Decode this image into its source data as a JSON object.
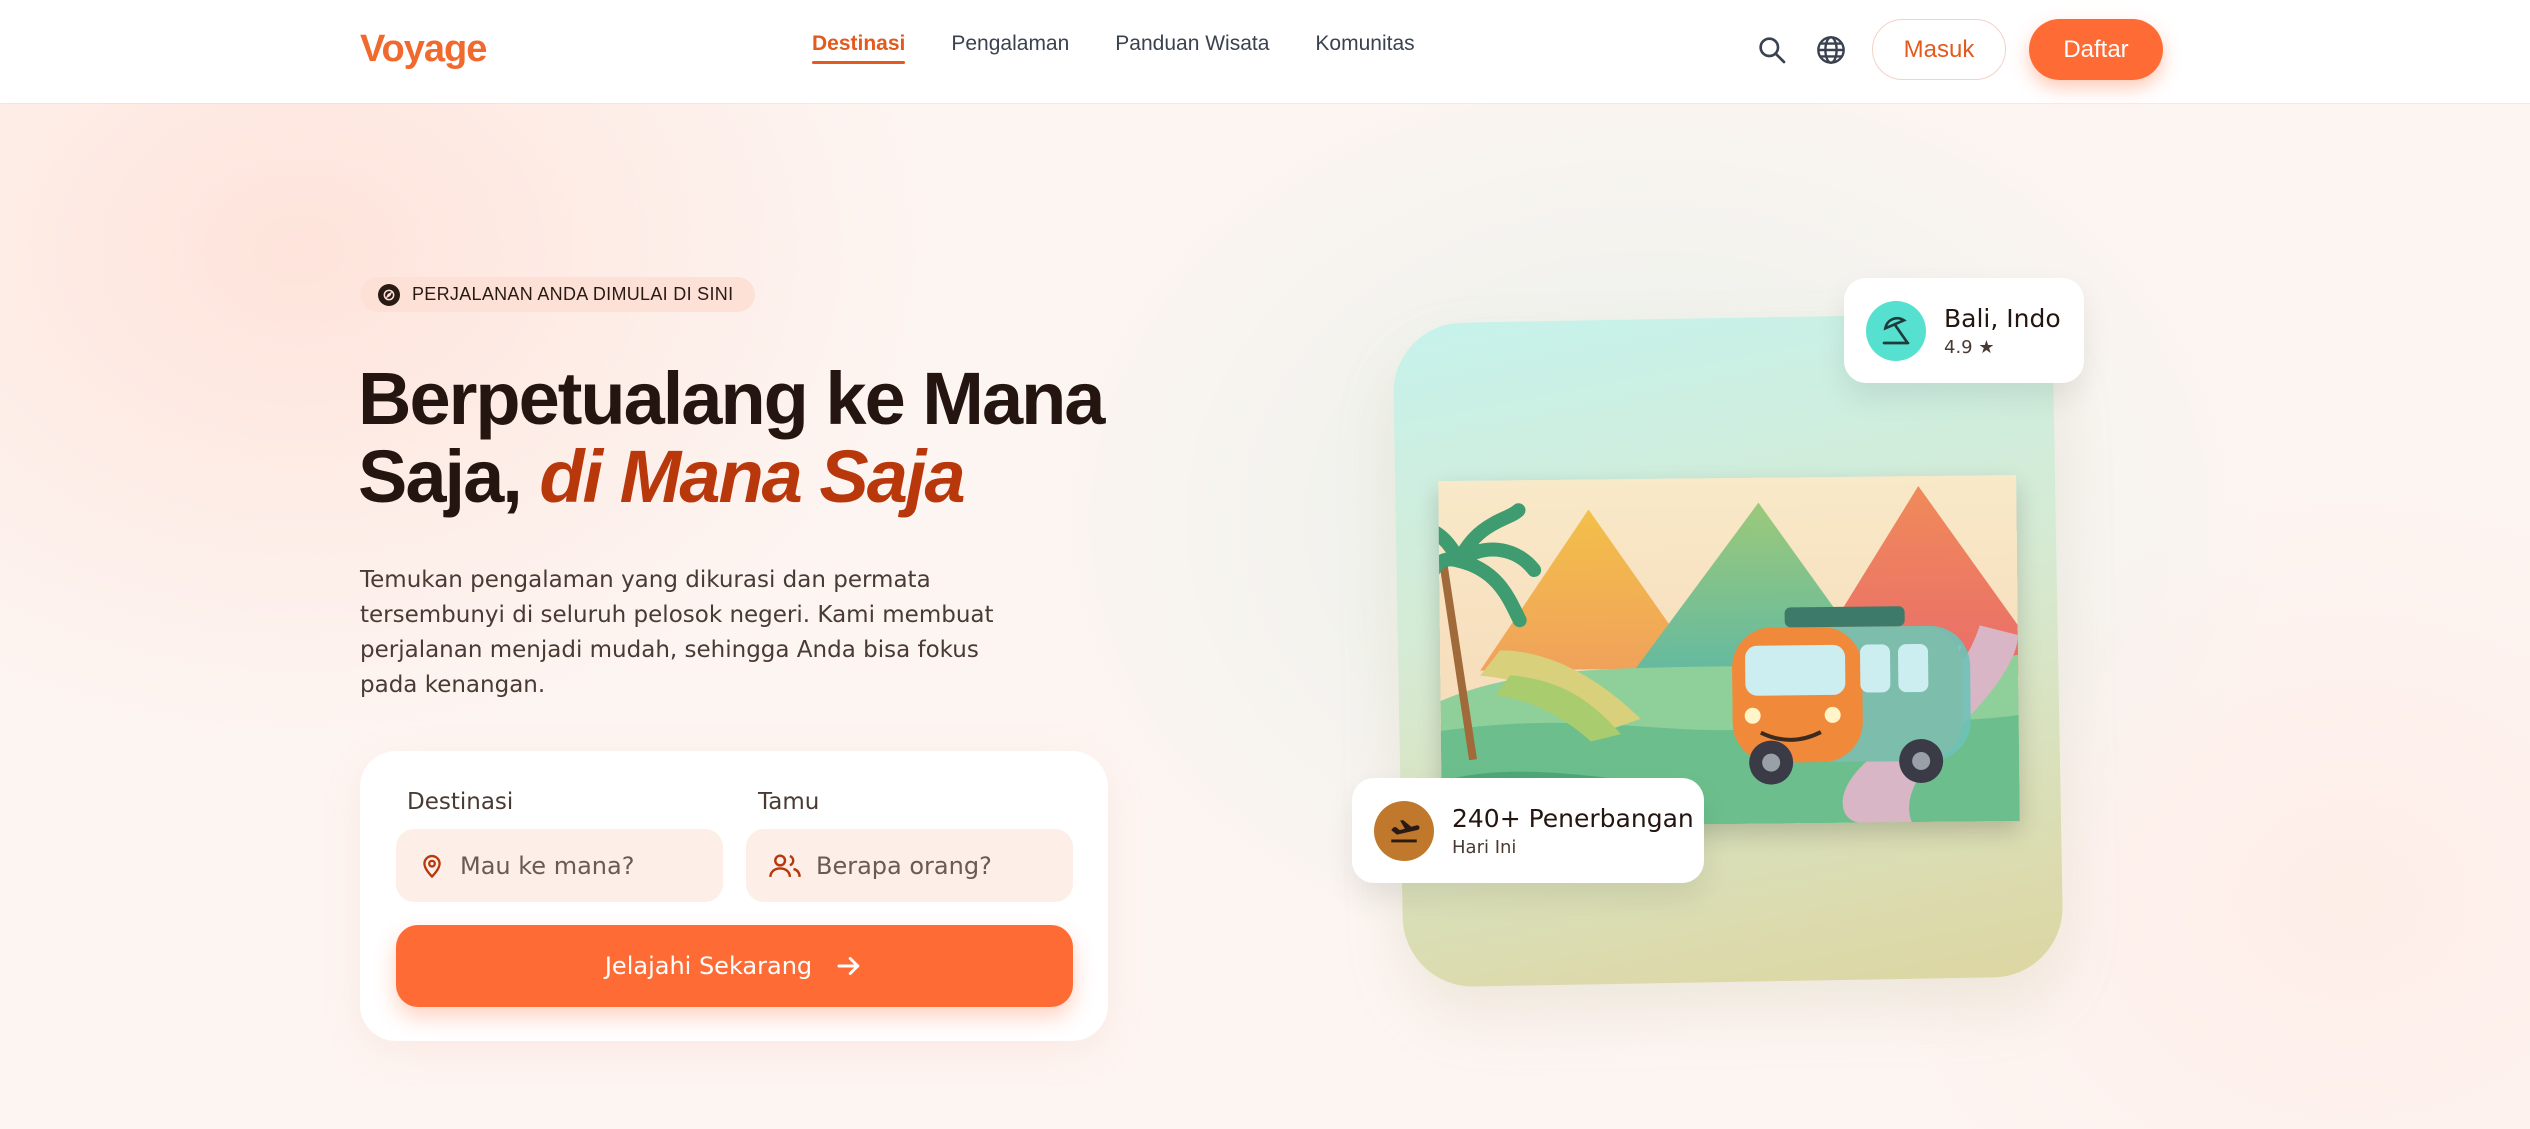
{
  "colors": {
    "accent": "#ff6b35",
    "accent_dark": "#b8380c",
    "nav_active": "#e35a1e",
    "badge_bg": "#fde1d6",
    "field_bg": "#fdeee8",
    "teal_icon": "#56e0d0",
    "bronze_icon": "#c0782c"
  },
  "nav": {
    "logo": "Voyage",
    "links": [
      {
        "label": "Destinasi",
        "active": true
      },
      {
        "label": "Pengalaman",
        "active": false
      },
      {
        "label": "Panduan Wisata",
        "active": false
      },
      {
        "label": "Komunitas",
        "active": false
      }
    ],
    "icons": [
      "search-icon",
      "globe-icon"
    ],
    "login_label": "Masuk",
    "signup_label": "Daftar"
  },
  "hero": {
    "badge_icon": "compass-icon",
    "badge": "PERJALANAN ANDA DIMULAI DI SINI",
    "headline_part1": "Berpetualang ke Mana Saja,",
    "headline_accent": "di Mana Saja",
    "description": "Temukan pengalaman yang dikurasi dan permata tersembunyi di seluruh pelosok negeri. Kami membuat perjalanan menjadi mudah, sehingga Anda bisa fokus pada kenangan."
  },
  "search": {
    "destination_label": "Destinasi",
    "destination_placeholder": "Mau ke mana?",
    "destination_icon": "map-pin-icon",
    "guests_label": "Tamu",
    "guests_placeholder": "Berapa orang?",
    "guests_icon": "users-icon",
    "cta_label": "Jelajahi Sekarang",
    "cta_icon": "arrow-right-icon"
  },
  "cards": {
    "location": {
      "icon": "beach-umbrella-icon",
      "title": "Bali, Indo",
      "rating": "4.9 ★"
    },
    "flights": {
      "icon": "flight-landing-icon",
      "title": "240+ Penerbangan",
      "subtitle": "Hari Ini"
    }
  }
}
